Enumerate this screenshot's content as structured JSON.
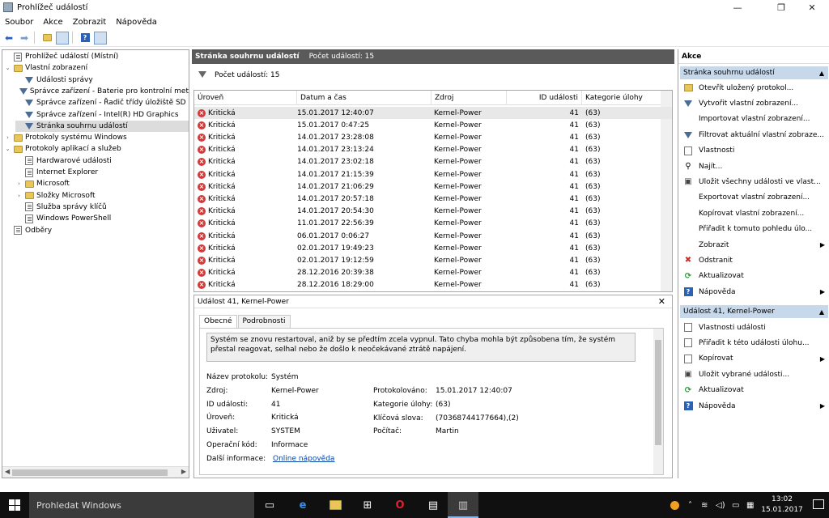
{
  "window": {
    "title": "Prohlížeč událostí",
    "controls": {
      "minimize": "—",
      "maximize": "❐",
      "close": "✕"
    }
  },
  "menu": [
    "Soubor",
    "Akce",
    "Zobrazit",
    "Nápověda"
  ],
  "toolbar_icons": [
    "back-arrow-icon",
    "forward-arrow-icon",
    "up-folder-icon",
    "show-hide-tree-icon",
    "help-icon",
    "show-hide-action-pane-icon"
  ],
  "tree": [
    {
      "label": "Prohlížeč událostí (Místní)",
      "level": 0,
      "icon": "logic",
      "twisty": ""
    },
    {
      "label": "Vlastní zobrazení",
      "level": 0,
      "icon": "folder",
      "twisty": "⌄"
    },
    {
      "label": "Události správy",
      "level": 1,
      "icon": "funnel",
      "twisty": ""
    },
    {
      "label": "Správce zařízení - Baterie pro kontrolní met",
      "level": 1,
      "icon": "funnel",
      "twisty": ""
    },
    {
      "label": "Správce zařízení - Řadič třídy úložiště SD",
      "level": 1,
      "icon": "funnel",
      "twisty": ""
    },
    {
      "label": "Správce zařízení - Intel(R) HD Graphics",
      "level": 1,
      "icon": "funnel",
      "twisty": ""
    },
    {
      "label": "Stránka souhrnu událostí",
      "level": 1,
      "icon": "funnel",
      "twisty": "",
      "selected": true
    },
    {
      "label": "Protokoly systému Windows",
      "level": 0,
      "icon": "folder",
      "twisty": "›"
    },
    {
      "label": "Protokoly aplikací a služeb",
      "level": 0,
      "icon": "folder",
      "twisty": "⌄"
    },
    {
      "label": "Hardwarové události",
      "level": 1,
      "icon": "logic",
      "twisty": ""
    },
    {
      "label": "Internet Explorer",
      "level": 1,
      "icon": "logic",
      "twisty": ""
    },
    {
      "label": "Microsoft",
      "level": 1,
      "icon": "folder",
      "twisty": "›"
    },
    {
      "label": "Složky Microsoft",
      "level": 1,
      "icon": "folder",
      "twisty": "›"
    },
    {
      "label": "Služba správy klíčů",
      "level": 1,
      "icon": "logic",
      "twisty": ""
    },
    {
      "label": "Windows PowerShell",
      "level": 1,
      "icon": "logic",
      "twisty": ""
    },
    {
      "label": "Odběry",
      "level": 0,
      "icon": "logic",
      "twisty": ""
    }
  ],
  "middle": {
    "header_title": "Stránka souhrnu událostí",
    "header_count": "Počet událostí: 15",
    "filter_text": "Počet událostí: 15",
    "columns": [
      "Úroveň",
      "Datum a čas",
      "Zdroj",
      "ID události",
      "Kategorie úlohy"
    ],
    "rows": [
      [
        "Kritická",
        "15.01.2017 12:40:07",
        "Kernel-Power",
        "41",
        "(63)"
      ],
      [
        "Kritická",
        "15.01.2017 0:47:25",
        "Kernel-Power",
        "41",
        "(63)"
      ],
      [
        "Kritická",
        "14.01.2017 23:28:08",
        "Kernel-Power",
        "41",
        "(63)"
      ],
      [
        "Kritická",
        "14.01.2017 23:13:24",
        "Kernel-Power",
        "41",
        "(63)"
      ],
      [
        "Kritická",
        "14.01.2017 23:02:18",
        "Kernel-Power",
        "41",
        "(63)"
      ],
      [
        "Kritická",
        "14.01.2017 21:15:39",
        "Kernel-Power",
        "41",
        "(63)"
      ],
      [
        "Kritická",
        "14.01.2017 21:06:29",
        "Kernel-Power",
        "41",
        "(63)"
      ],
      [
        "Kritická",
        "14.01.2017 20:57:18",
        "Kernel-Power",
        "41",
        "(63)"
      ],
      [
        "Kritická",
        "14.01.2017 20:54:30",
        "Kernel-Power",
        "41",
        "(63)"
      ],
      [
        "Kritická",
        "11.01.2017 22:56:39",
        "Kernel-Power",
        "41",
        "(63)"
      ],
      [
        "Kritická",
        "06.01.2017 0:06:27",
        "Kernel-Power",
        "41",
        "(63)"
      ],
      [
        "Kritická",
        "02.01.2017 19:49:23",
        "Kernel-Power",
        "41",
        "(63)"
      ],
      [
        "Kritická",
        "02.01.2017 19:12:59",
        "Kernel-Power",
        "41",
        "(63)"
      ],
      [
        "Kritická",
        "28.12.2016 20:39:38",
        "Kernel-Power",
        "41",
        "(63)"
      ],
      [
        "Kritická",
        "28.12.2016 18:29:00",
        "Kernel-Power",
        "41",
        "(63)"
      ]
    ],
    "detail": {
      "title": "Událost 41, Kernel-Power",
      "close": "✕",
      "tabs": [
        "Obecné",
        "Podrobnosti"
      ],
      "description": "Systém se znovu restartoval, aniž by se předtím zcela vypnul. Tato chyba mohla být způsobena tím, že systém přestal reagovat, selhal nebo že došlo k neočekávané ztrátě napájení.",
      "left_fields": [
        {
          "key": "Název protokolu:",
          "value": "Systém"
        },
        {
          "key": "Zdroj:",
          "value": "Kernel-Power"
        },
        {
          "key": "ID události:",
          "value": "41"
        },
        {
          "key": "Úroveň:",
          "value": "Kritická"
        },
        {
          "key": "Uživatel:",
          "value": "SYSTEM"
        },
        {
          "key": "Operační kód:",
          "value": "Informace"
        },
        {
          "key": "Další informace:",
          "value": "Online nápověda"
        }
      ],
      "right_fields": [
        {
          "key": "Protokolováno:",
          "value": "15.01.2017 12:40:07"
        },
        {
          "key": "Kategorie úlohy:",
          "value": "(63)"
        },
        {
          "key": "Klíčová slova:",
          "value": "(70368744177664),(2)"
        },
        {
          "key": "Počítač:",
          "value": "Martin"
        }
      ]
    }
  },
  "actions": {
    "title": "Akce",
    "section1": "Stránka souhrnu událostí",
    "items1": [
      {
        "label": "Otevřít uložený protokol...",
        "icon": "open"
      },
      {
        "label": "Vytvořit vlastní zobrazení...",
        "icon": "funnel"
      },
      {
        "label": "Importovat vlastní zobrazení...",
        "icon": ""
      },
      {
        "label": "Filtrovat aktuální vlastní zobraze...",
        "icon": "funnel"
      },
      {
        "label": "Vlastnosti",
        "icon": "page"
      },
      {
        "label": "Najít...",
        "icon": "find"
      },
      {
        "label": "Uložit všechny události ve vlast...",
        "icon": "save"
      },
      {
        "label": "Exportovat vlastní zobrazení...",
        "icon": ""
      },
      {
        "label": "Kopírovat vlastní zobrazení...",
        "icon": ""
      },
      {
        "label": "Přiřadit k tomuto pohledu úlo...",
        "icon": ""
      },
      {
        "label": "Zobrazit",
        "icon": "",
        "submenu": true
      },
      {
        "label": "Odstranit",
        "icon": "delete"
      },
      {
        "label": "Aktualizovat",
        "icon": "refresh"
      },
      {
        "label": "Nápověda",
        "icon": "help",
        "submenu": true
      }
    ],
    "section2": "Událost 41, Kernel-Power",
    "items2": [
      {
        "label": "Vlastnosti události",
        "icon": "page"
      },
      {
        "label": "Přiřadit k této události úlohu...",
        "icon": "task"
      },
      {
        "label": "Kopírovat",
        "icon": "copy",
        "submenu": true
      },
      {
        "label": "Uložit vybrané události...",
        "icon": "save"
      },
      {
        "label": "Aktualizovat",
        "icon": "refresh"
      },
      {
        "label": "Nápověda",
        "icon": "help",
        "submenu": true
      }
    ]
  },
  "taskbar": {
    "search_placeholder": "Prohledat Windows",
    "time": "13:02",
    "date": "15.01.2017"
  }
}
